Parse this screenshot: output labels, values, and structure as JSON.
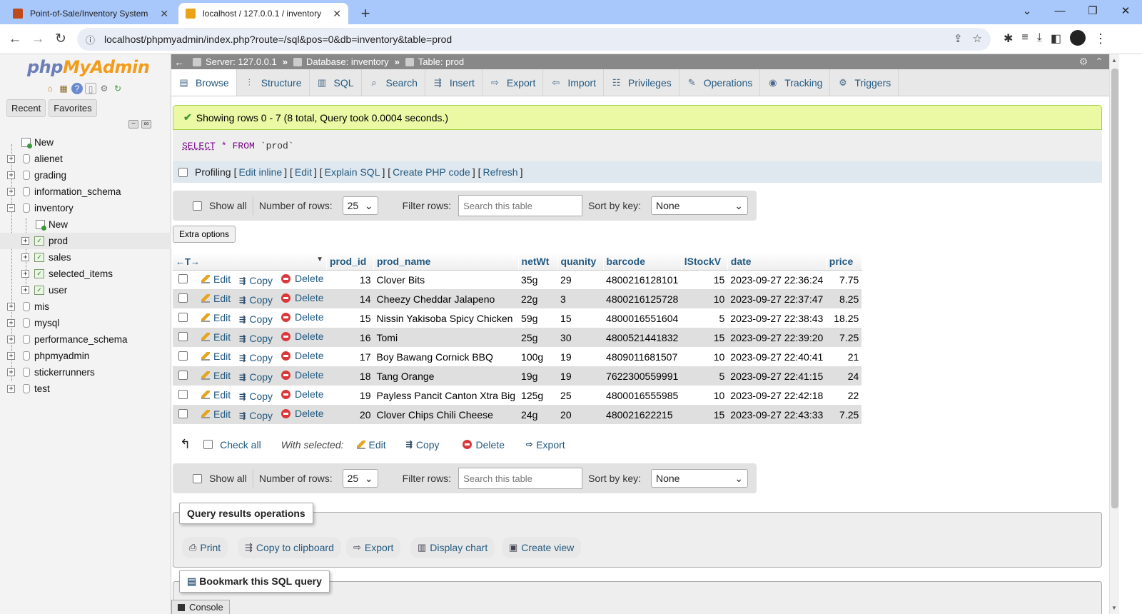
{
  "browser": {
    "tabs": [
      {
        "title": "Point-of-Sale/Inventory System",
        "active": false,
        "favicon_color": "#c04a1a"
      },
      {
        "title": "localhost / 127.0.0.1 / inventory",
        "active": true,
        "favicon_color": "#e8a317"
      }
    ],
    "url": "localhost/phpmyadmin/index.php?route=/sql&pos=0&db=inventory&table=prod",
    "icons": {
      "back": "arrow-left-icon",
      "forward": "arrow-right-icon",
      "reload": "reload-icon",
      "share": "share-icon",
      "bookmark": "star-icon"
    }
  },
  "sidebar": {
    "logo_php": "php",
    "logo_my": "MyAdmin",
    "tabs": [
      "Recent",
      "Favorites"
    ],
    "tree": [
      {
        "label": "New",
        "type": "new",
        "level": 0
      },
      {
        "label": "alienet",
        "type": "db",
        "level": 0
      },
      {
        "label": "grading",
        "type": "db",
        "level": 0
      },
      {
        "label": "information_schema",
        "type": "db",
        "level": 0
      },
      {
        "label": "inventory",
        "type": "db",
        "level": 0,
        "expanded": true
      },
      {
        "label": "New",
        "type": "new",
        "level": 1
      },
      {
        "label": "prod",
        "type": "table",
        "level": 1,
        "selected": true
      },
      {
        "label": "sales",
        "type": "table",
        "level": 1
      },
      {
        "label": "selected_items",
        "type": "table",
        "level": 1
      },
      {
        "label": "user",
        "type": "table",
        "level": 1
      },
      {
        "label": "mis",
        "type": "db",
        "level": 0
      },
      {
        "label": "mysql",
        "type": "db",
        "level": 0
      },
      {
        "label": "performance_schema",
        "type": "db",
        "level": 0
      },
      {
        "label": "phpmyadmin",
        "type": "db",
        "level": 0
      },
      {
        "label": "stickerrunners",
        "type": "db",
        "level": 0
      },
      {
        "label": "test",
        "type": "db",
        "level": 0
      }
    ]
  },
  "breadcrumb": {
    "server": "Server: 127.0.0.1",
    "database": "Database: inventory",
    "table": "Table: prod"
  },
  "menu": [
    {
      "label": "Browse",
      "icon": "browse-icon",
      "glyph": "▤"
    },
    {
      "label": "Structure",
      "icon": "structure-icon",
      "glyph": "⫶"
    },
    {
      "label": "SQL",
      "icon": "sql-icon",
      "glyph": "▥"
    },
    {
      "label": "Search",
      "icon": "search-icon",
      "glyph": "⌕"
    },
    {
      "label": "Insert",
      "icon": "insert-icon",
      "glyph": "⇶"
    },
    {
      "label": "Export",
      "icon": "export-icon",
      "glyph": "⇨"
    },
    {
      "label": "Import",
      "icon": "import-icon",
      "glyph": "⇦"
    },
    {
      "label": "Privileges",
      "icon": "privileges-icon",
      "glyph": "☷"
    },
    {
      "label": "Operations",
      "icon": "operations-icon",
      "glyph": "✎"
    },
    {
      "label": "Tracking",
      "icon": "tracking-icon",
      "glyph": "◉"
    },
    {
      "label": "Triggers",
      "icon": "triggers-icon",
      "glyph": "⚙"
    }
  ],
  "message": {
    "success": "Showing rows 0 - 7 (8 total, Query took 0.0004 seconds.)"
  },
  "sql": {
    "select": "SELECT",
    "star": "*",
    "from": "FROM",
    "table": "`prod`"
  },
  "profiling": {
    "label": "Profiling",
    "links": [
      "Edit inline",
      "Edit",
      "Explain SQL",
      "Create PHP code",
      "Refresh"
    ]
  },
  "navbar": {
    "show_all": "Show all",
    "rows_label": "Number of rows:",
    "rows_value": "25",
    "filter_label": "Filter rows:",
    "filter_placeholder": "Search this table",
    "sort_label": "Sort by key:",
    "sort_value": "None"
  },
  "extra_options": "Extra options",
  "table": {
    "columns": [
      "prod_id",
      "prod_name",
      "netWt",
      "quanity",
      "barcode",
      "lStockV",
      "date",
      "price"
    ],
    "actions": {
      "edit": "Edit",
      "copy": "Copy",
      "delete": "Delete"
    },
    "rows": [
      [
        "13",
        "Clover Bits",
        "35g",
        "29",
        "4800216128101",
        "15",
        "2023-09-27 22:36:24",
        "7.75"
      ],
      [
        "14",
        "Cheezy Cheddar Jalapeno",
        "22g",
        "3",
        "4800216125728",
        "10",
        "2023-09-27 22:37:47",
        "8.25"
      ],
      [
        "15",
        "Nissin Yakisoba Spicy Chicken",
        "59g",
        "15",
        "4800016551604",
        "5",
        "2023-09-27 22:38:43",
        "18.25"
      ],
      [
        "16",
        "Tomi",
        "25g",
        "30",
        "4800521441832",
        "15",
        "2023-09-27 22:39:20",
        "7.25"
      ],
      [
        "17",
        "Boy Bawang Cornick BBQ",
        "100g",
        "19",
        "4809011681507",
        "10",
        "2023-09-27 22:40:41",
        "21"
      ],
      [
        "18",
        "Tang Orange",
        "19g",
        "19",
        "7622300559991",
        "5",
        "2023-09-27 22:41:15",
        "24"
      ],
      [
        "19",
        "Payless Pancit Canton Xtra Big",
        "125g",
        "25",
        "4800016555985",
        "10",
        "2023-09-27 22:42:18",
        "22"
      ],
      [
        "20",
        "Clover Chips Chili Cheese",
        "24g",
        "20",
        "480021622215",
        "15",
        "2023-09-27 22:43:33",
        "7.25"
      ]
    ]
  },
  "with_selected": {
    "check_all": "Check all",
    "label": "With selected:",
    "edit": "Edit",
    "copy": "Copy",
    "delete": "Delete",
    "export": "Export"
  },
  "query_ops": {
    "title": "Query results operations",
    "buttons": [
      "Print",
      "Copy to clipboard",
      "Export",
      "Display chart",
      "Create view"
    ]
  },
  "bookmark": {
    "title": "Bookmark this SQL query"
  },
  "console": {
    "label": "Console"
  }
}
